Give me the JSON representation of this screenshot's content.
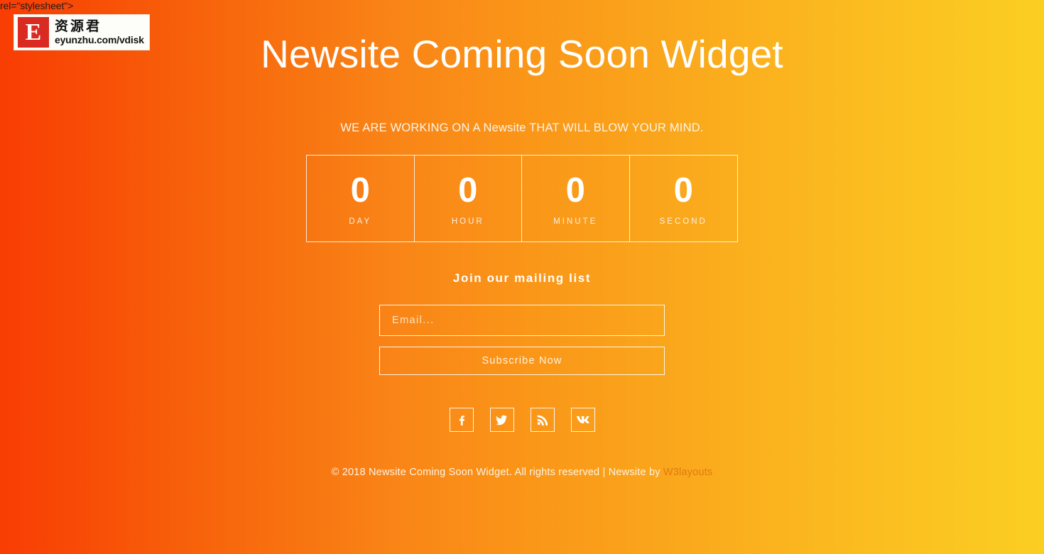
{
  "stray_markup_text": "rel=\"stylesheet\">",
  "logo": {
    "mark_letter": "E",
    "chinese_name": "资源君",
    "url": "eyunzhu.com/vdisk"
  },
  "hero": {
    "title": "Newsite Coming Soon Widget",
    "tagline": "WE ARE WORKING ON A Newsite THAT WILL BLOW YOUR MIND."
  },
  "countdown": {
    "units": [
      {
        "value": "0",
        "label": "DAY"
      },
      {
        "value": "0",
        "label": "HOUR"
      },
      {
        "value": "0",
        "label": "MINUTE"
      },
      {
        "value": "0",
        "label": "SECOND"
      }
    ]
  },
  "mailing_list": {
    "heading": "Join our mailing list",
    "email_placeholder": "Email...",
    "email_value": "",
    "subscribe_label": "Subscribe Now"
  },
  "social": {
    "links": [
      {
        "name": "facebook",
        "glyph": "f"
      },
      {
        "name": "twitter",
        "glyph": "t"
      },
      {
        "name": "rss",
        "glyph": "r"
      },
      {
        "name": "vk",
        "glyph": "v"
      }
    ]
  },
  "footer": {
    "text": "© 2018 Newsite Coming Soon Widget. All rights reserved | Newsite by ",
    "link_label": "W3layouts"
  },
  "colors": {
    "gradient_start": "#f93d04",
    "gradient_mid": "#f98517",
    "gradient_end": "#fbce22",
    "text_white": "#ffffff",
    "link_accent": "#e07b10",
    "logo_red": "#d92b22"
  }
}
